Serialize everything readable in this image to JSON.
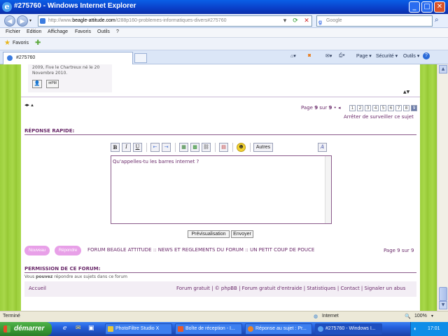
{
  "window": {
    "title": "#275760 - Windows Internet Explorer",
    "minimize": "_",
    "maximize": "□",
    "close": "✕"
  },
  "address": {
    "url_prefix": "http://www.",
    "url_host": "beagle-attitude.com",
    "url_rest": "/t288p160-problemes-informatiques-divers#275760",
    "search_placeholder": "Google"
  },
  "menu": [
    "Fichier",
    "Edition",
    "Affichage",
    "Favoris",
    "Outils",
    "?"
  ],
  "favorites": {
    "label": "Favoris"
  },
  "tab": {
    "label": "#275760"
  },
  "toolbar": {
    "page": "Page ▾",
    "security": "Sécurité ▾",
    "tools": "Outils ▾",
    "help": "?"
  },
  "post": {
    "join_text_1": "2009, Five le Chartreux né le 20",
    "join_text_2": "Novembre 2010."
  },
  "pagination": {
    "page_prefix": "Page",
    "current": "9",
    "sur": "sur",
    "total": "9",
    "pages": [
      "1",
      "2",
      "3",
      "4",
      "5",
      "6",
      "7",
      "8",
      "9"
    ],
    "stop_watch": "Arrêter de surveiller ce sujet"
  },
  "quick_reply": {
    "heading": "RÉPONSE RAPIDE:",
    "format_buttons": [
      "B",
      "I",
      "U"
    ],
    "others_button": "Autres",
    "textarea_value": "Qu'appelles-tu les barres internet ?",
    "preview_button": "Prévisualisation",
    "send_button": "Envoyer"
  },
  "footer_nav": {
    "nouveau": "Nouveau",
    "repondre": "Répondre",
    "breadcrumb": "FORUM BEAGLE ATTITUDE :: NEWS ET REGLEMENTS DU FORUM :: UN PETIT COUP DE POUCE",
    "page_text": "Page 9 sur 9"
  },
  "permissions": {
    "heading": "PERMISSION DE CE FORUM:",
    "text_pre": "Vous ",
    "text_bold": "pouvez",
    "text_post": " répondre aux sujets dans ce forum"
  },
  "forum_footer": {
    "accueil": "Accueil",
    "links": "Forum gratuit | © phpBB | Forum gratuit d'entraide | Statistiques | Contact | Signaler un abus"
  },
  "status": {
    "left": "Terminé",
    "zone": "Internet",
    "zoom": "100%"
  },
  "taskbar": {
    "start": "démarrer",
    "items": [
      "PhotoFiltre Studio X",
      "Boîte de réception - I...",
      "Réponse au sujet : Pr...",
      "#275760 - Windows I..."
    ],
    "clock": "17:01"
  }
}
